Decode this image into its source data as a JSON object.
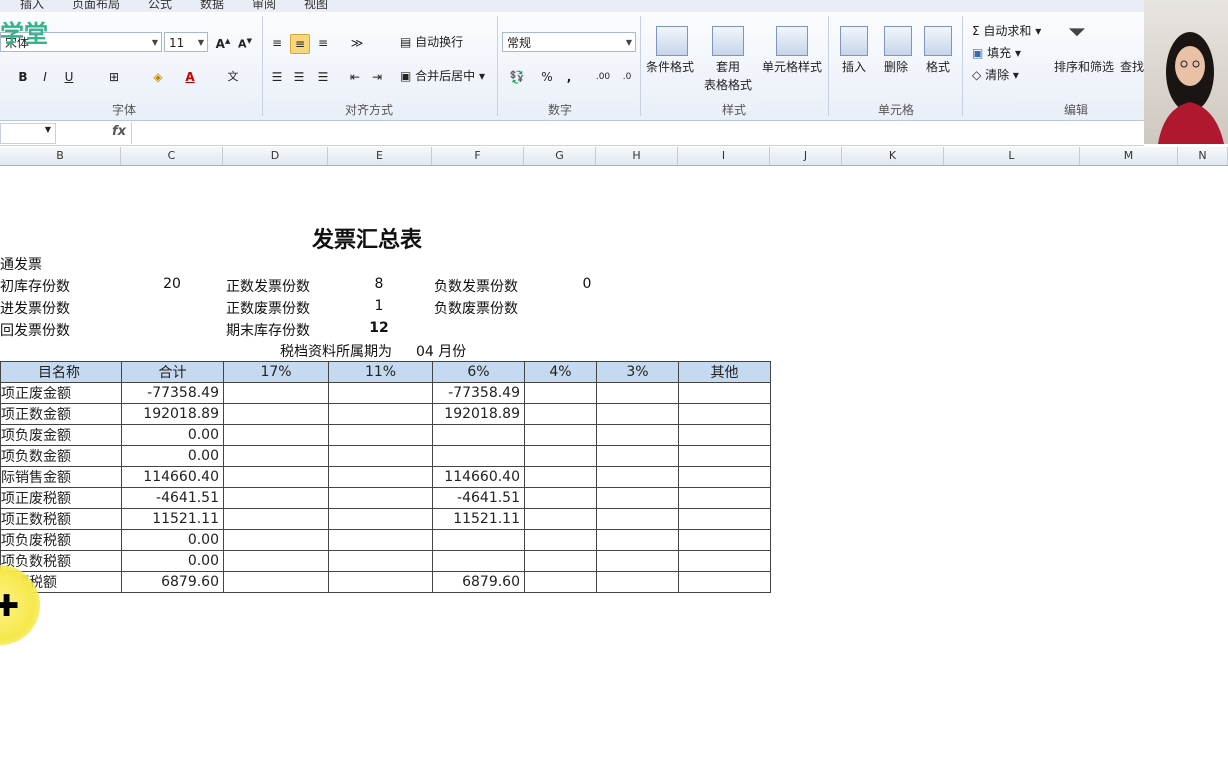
{
  "ribbon": {
    "tabs": [
      "插入",
      "页面布局",
      "公式",
      "数据",
      "审阅",
      "视图"
    ],
    "logo_text": "学堂",
    "font_name": "宋体",
    "font_size": "11",
    "number_format": "常规",
    "wrap_text": "自动换行",
    "merge_center": "合并后居中",
    "conditional_format": "条件格式",
    "table_format_1": "套用",
    "table_format_2": "表格格式",
    "cell_styles": "单元格样式",
    "insert": "插入",
    "delete": "删除",
    "format": "格式",
    "autosum": "自动求和",
    "fill": "填充",
    "clear": "清除",
    "sort_filter": "排序和筛选",
    "find": "查找",
    "groups": {
      "font": "字体",
      "alignment": "对齐方式",
      "number": "数字",
      "styles": "样式",
      "cells": "单元格",
      "editing": "编辑"
    }
  },
  "formula_bar": {
    "fx": "fx",
    "value": ""
  },
  "columns": [
    "B",
    "C",
    "D",
    "E",
    "F",
    "G",
    "H",
    "I",
    "J",
    "K",
    "L",
    "M",
    "N"
  ],
  "sheet": {
    "title": "发票汇总表",
    "section": "通发票",
    "info": [
      {
        "label": "初库存份数",
        "value": "20",
        "label2": "正数发票份数",
        "value2": "8",
        "label3": "负数发票份数",
        "value3": "0"
      },
      {
        "label": "进发票份数",
        "value": "",
        "label2": "正数废票份数",
        "value2": "1",
        "label3": "负数废票份数",
        "value3": ""
      },
      {
        "label": "回发票份数",
        "value": "",
        "label2": "期末库存份数",
        "value2": "12",
        "label3": "",
        "value3": ""
      }
    ],
    "period_label": "税档资料所属期为",
    "period_value": "04 月份",
    "table_header": [
      "目名称",
      "合计",
      "17%",
      "11%",
      "6%",
      "4%",
      "3%",
      "其他"
    ],
    "rows": [
      [
        "项正废金额",
        "-77358.49",
        "",
        "",
        "-77358.49",
        "",
        "",
        ""
      ],
      [
        "项正数金额",
        "192018.89",
        "",
        "",
        "192018.89",
        "",
        "",
        ""
      ],
      [
        "项负废金额",
        "0.00",
        "",
        "",
        "",
        "",
        "",
        ""
      ],
      [
        "项负数金额",
        "0.00",
        "",
        "",
        "",
        "",
        "",
        ""
      ],
      [
        "际销售金额",
        "114660.40",
        "",
        "",
        "114660.40",
        "",
        "",
        ""
      ],
      [
        "项正废税额",
        "-4641.51",
        "",
        "",
        "-4641.51",
        "",
        "",
        ""
      ],
      [
        "项正数税额",
        "11521.11",
        "",
        "",
        "11521.11",
        "",
        "",
        ""
      ],
      [
        "项负废税额",
        "0.00",
        "",
        "",
        "",
        "",
        "",
        ""
      ],
      [
        "项负数税额",
        "0.00",
        "",
        "",
        "",
        "",
        "",
        ""
      ],
      [
        "销项税额",
        "6879.60",
        "",
        "",
        "6879.60",
        "",
        "",
        ""
      ]
    ]
  }
}
